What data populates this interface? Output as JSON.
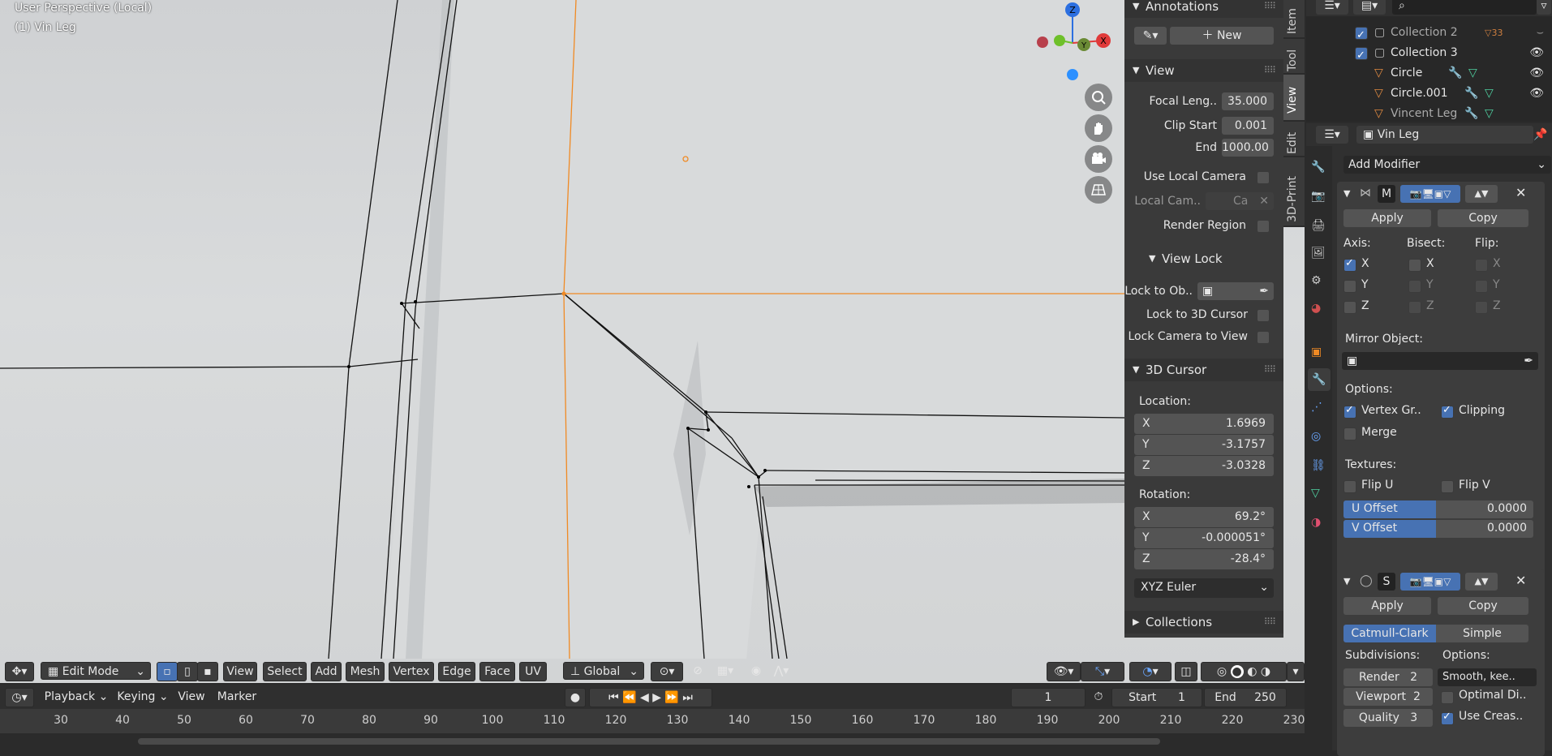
{
  "viewport": {
    "title": "User Perspective (Local)",
    "object_label": "(1) Vin Leg",
    "gizmo_axes": {
      "z": "Z",
      "y": "Y",
      "x": "X"
    }
  },
  "viewport_header": {
    "mode": "Edit Mode",
    "menus": [
      "View",
      "Select",
      "Add",
      "Mesh",
      "Vertex",
      "Edge",
      "Face",
      "UV"
    ],
    "transform_orientation": "Global"
  },
  "npanel": {
    "annotations": {
      "title": "Annotations",
      "new_label": "New"
    },
    "view": {
      "title": "View",
      "focal_label": "Focal Leng..",
      "focal_value": "35.000",
      "clip_start_label": "Clip Start",
      "clip_start_value": "0.001",
      "end_label": "End",
      "end_value": "1000.00",
      "use_local_camera": "Use Local Camera",
      "local_camera_label": "Local Cam..",
      "local_camera_value": "Ca",
      "render_region": "Render Region"
    },
    "view_lock": {
      "title": "View Lock",
      "lock_to_obj": "Lock to Ob..",
      "lock_to_cursor": "Lock to 3D Cursor",
      "lock_camera": "Lock Camera to View"
    },
    "cursor": {
      "title": "3D Cursor",
      "location_label": "Location:",
      "loc": [
        {
          "axis": "X",
          "value": "1.6969"
        },
        {
          "axis": "Y",
          "value": "-3.1757"
        },
        {
          "axis": "Z",
          "value": "-3.0328"
        }
      ],
      "rotation_label": "Rotation:",
      "rot": [
        {
          "axis": "X",
          "value": "69.2°"
        },
        {
          "axis": "Y",
          "value": "-0.000051°"
        },
        {
          "axis": "Z",
          "value": "-28.4°"
        }
      ],
      "rotation_mode": "XYZ Euler"
    },
    "collections": {
      "title": "Collections"
    },
    "tabs": [
      "Item",
      "Tool",
      "View",
      "Edit",
      "3D-Print"
    ]
  },
  "outliner": {
    "rows": [
      {
        "name": "Collection 2",
        "badge": "33"
      },
      {
        "name": "Collection 3"
      },
      {
        "name": "Circle"
      },
      {
        "name": "Circle.001"
      },
      {
        "name": "Vincent Leg"
      }
    ]
  },
  "properties": {
    "object_name": "Vin Leg",
    "add_modifier": "Add Modifier",
    "mirror": {
      "letter": "M",
      "apply": "Apply",
      "copy": "Copy",
      "axis_label": "Axis:",
      "bisect_label": "Bisect:",
      "flip_label": "Flip:",
      "axes": [
        "X",
        "Y",
        "Z"
      ],
      "mirror_object_label": "Mirror Object:",
      "options_label": "Options:",
      "vertex_groups": "Vertex Gr..",
      "clipping": "Clipping",
      "merge": "Merge",
      "textures_label": "Textures:",
      "flip_u": "Flip U",
      "flip_v": "Flip V",
      "u_offset_label": "U Offset",
      "u_offset_value": "0.0000",
      "v_offset_label": "V Offset",
      "v_offset_value": "0.0000"
    },
    "subsurf": {
      "letter": "S",
      "apply": "Apply",
      "copy": "Copy",
      "catmull": "Catmull-Clark",
      "simple": "Simple",
      "subdivisions_label": "Subdivisions:",
      "options_label": "Options:",
      "render_label": "Render",
      "render_value": "2",
      "viewport_label": "Viewport",
      "viewport_value": "2",
      "quality_label": "Quality",
      "quality_value": "3",
      "smooth_label": "Smooth, kee..",
      "optimal_label": "Optimal Di..",
      "use_crease_label": "Use Creas.."
    }
  },
  "timeline": {
    "menus": [
      "Playback",
      "Keying",
      "View",
      "Marker"
    ],
    "current_frame": "1",
    "start_label": "Start",
    "start_value": "1",
    "end_label": "End",
    "end_value": "250",
    "ticks": [
      "30",
      "40",
      "50",
      "60",
      "70",
      "80",
      "90",
      "100",
      "110",
      "120",
      "130",
      "140",
      "150",
      "160",
      "170",
      "180",
      "190",
      "200",
      "210",
      "220",
      "230"
    ]
  },
  "colors": {
    "accent": "#4772b3",
    "selection": "#f08a24",
    "panel": "#3a3a3a"
  }
}
